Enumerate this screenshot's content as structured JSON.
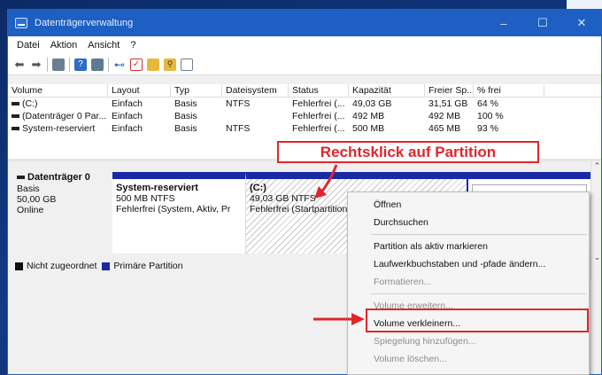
{
  "window": {
    "title": "Datenträgerverwaltung",
    "controls": [
      "–",
      "☐",
      "✕"
    ]
  },
  "menubar": [
    "Datei",
    "Aktion",
    "Ansicht",
    "?"
  ],
  "toolbar": {
    "icons": [
      "back-arrow-icon",
      "forward-arrow-icon",
      "grid-icon",
      "help-icon",
      "console-icon",
      "connect-icon",
      "check-icon",
      "folder-icon",
      "search-icon",
      "window-icon"
    ]
  },
  "volume_list": {
    "headers": [
      "Volume",
      "Layout",
      "Typ",
      "Dateisystem",
      "Status",
      "Kapazität",
      "Freier Sp...",
      "% frei",
      ""
    ],
    "rows": [
      [
        "(C:)",
        "Einfach",
        "Basis",
        "NTFS",
        "Fehlerfrei (...",
        "49,03 GB",
        "31,51 GB",
        "64 %"
      ],
      [
        "(Datenträger 0 Par...",
        "Einfach",
        "Basis",
        "",
        "Fehlerfrei (...",
        "492 MB",
        "492 MB",
        "100 %"
      ],
      [
        "System-reserviert",
        "Einfach",
        "Basis",
        "NTFS",
        "Fehlerfrei (...",
        "500 MB",
        "465 MB",
        "93 %"
      ]
    ]
  },
  "disk": {
    "name": "Datenträger 0",
    "type": "Basis",
    "size": "50,00 GB",
    "state": "Online",
    "partitions": [
      {
        "name": "System-reserviert",
        "size": "500 MB NTFS",
        "status": "Fehlerfrei (System, Aktiv, Pr"
      },
      {
        "name": "(C:)",
        "size": "49,03 GB NTFS",
        "status": "Fehlerfrei (Startpartition,"
      }
    ]
  },
  "legend": [
    {
      "label": "Nicht zugeordnet",
      "color": "#111111"
    },
    {
      "label": "Primäre Partition",
      "color": "#1a2aa5"
    }
  ],
  "callout": {
    "text": "Rechtsklick auf Partition",
    "color": "#e0262b"
  },
  "context_menu": {
    "groups": [
      [
        {
          "label": "Öffnen",
          "enabled": true
        },
        {
          "label": "Durchsuchen",
          "enabled": true
        }
      ],
      [
        {
          "label": "Partition als aktiv markieren",
          "enabled": true
        },
        {
          "label": "Laufwerkbuchstaben und -pfade ändern...",
          "enabled": true
        },
        {
          "label": "Formatieren...",
          "enabled": false
        }
      ],
      [
        {
          "label": "Volume erweitern...",
          "enabled": false
        },
        {
          "label": "Volume verkleinern...",
          "enabled": true
        },
        {
          "label": "Spiegelung hinzufügen...",
          "enabled": false
        },
        {
          "label": "Volume löschen...",
          "enabled": false
        }
      ]
    ]
  },
  "colors": {
    "titlebar": "#1d5fc2",
    "partition_bar": "#1a2aa5",
    "annotation": "#e0262b"
  }
}
